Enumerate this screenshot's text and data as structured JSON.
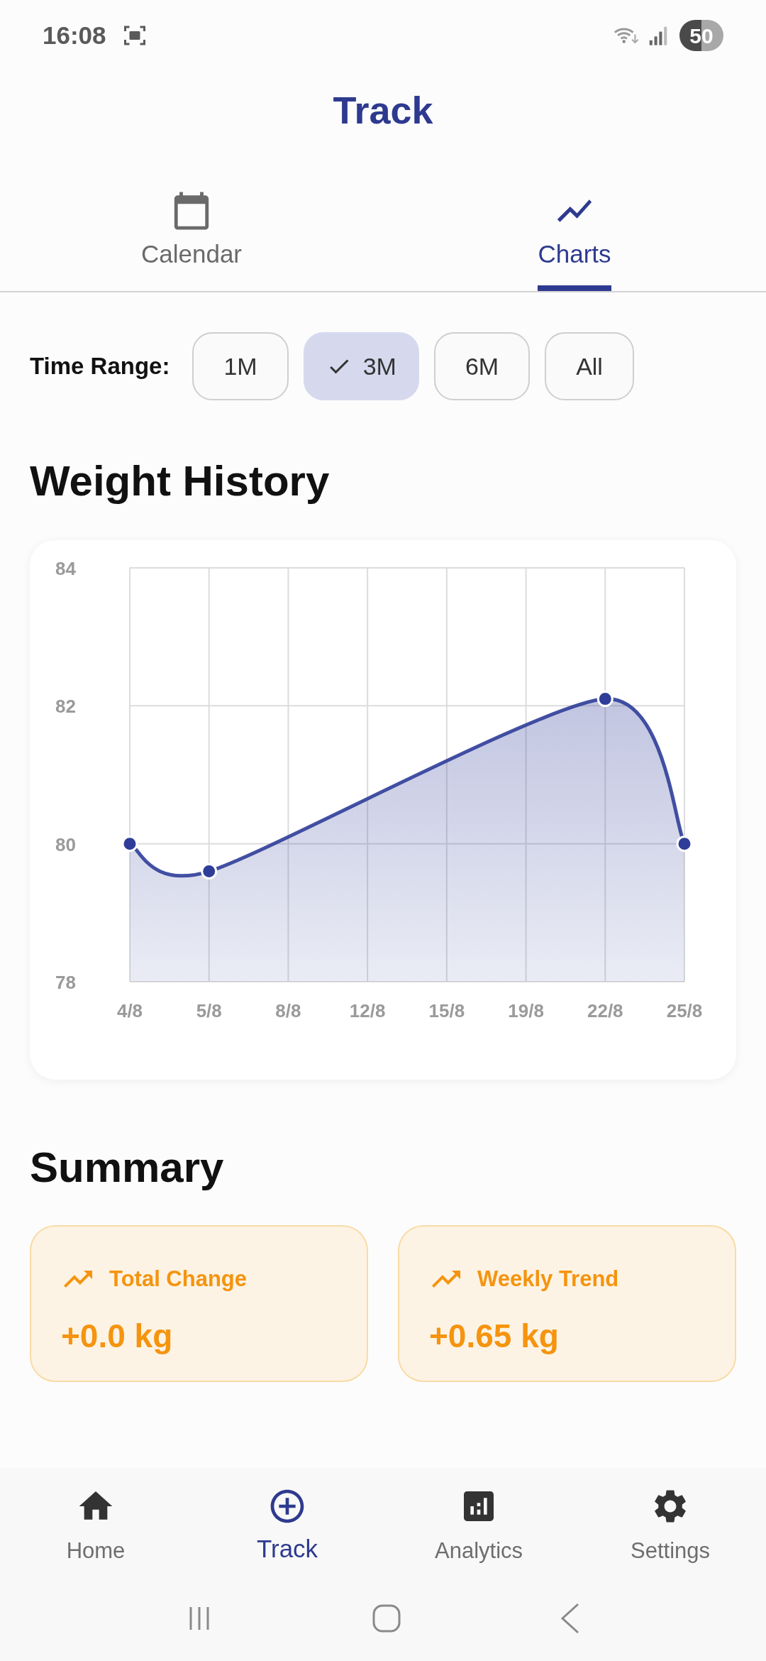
{
  "status_bar": {
    "time": "16:08",
    "battery": "50"
  },
  "header": {
    "title": "Track"
  },
  "tabs": [
    {
      "label": "Calendar",
      "selected": false
    },
    {
      "label": "Charts",
      "selected": true
    }
  ],
  "time_range": {
    "label": "Time Range:",
    "options": [
      {
        "label": "1M",
        "selected": false
      },
      {
        "label": "3M",
        "selected": true
      },
      {
        "label": "6M",
        "selected": false
      },
      {
        "label": "All",
        "selected": false
      }
    ]
  },
  "weight_history": {
    "title": "Weight History",
    "chart_data": {
      "type": "area",
      "categories": [
        "4/8",
        "5/8",
        "8/8",
        "12/8",
        "15/8",
        "19/8",
        "22/8",
        "25/8"
      ],
      "grid": true,
      "series": [
        {
          "color": "#2f3d99",
          "values": [
            80,
            79.6,
            null,
            null,
            null,
            null,
            82.1,
            80
          ]
        }
      ],
      "ylim": [
        78,
        84
      ],
      "yticks": [
        78,
        80,
        82,
        84
      ]
    }
  },
  "summary": {
    "title": "Summary",
    "cards": [
      {
        "label": "Total Change",
        "value": "+0.0 kg"
      },
      {
        "label": "Weekly Trend",
        "value": "+0.65 kg"
      }
    ]
  },
  "bottom_nav": [
    {
      "label": "Home",
      "selected": false
    },
    {
      "label": "Track",
      "selected": true
    },
    {
      "label": "Analytics",
      "selected": false
    },
    {
      "label": "Settings",
      "selected": false
    }
  ]
}
